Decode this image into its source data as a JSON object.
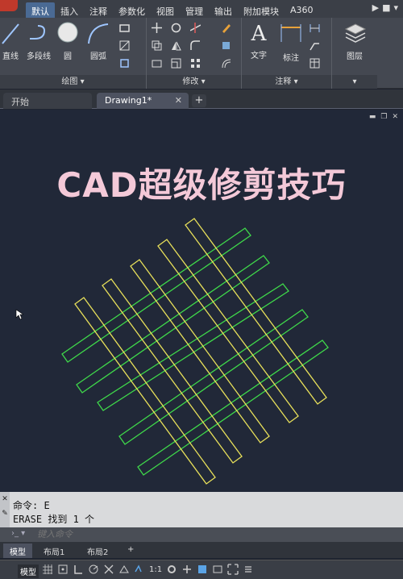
{
  "ribbon": {
    "tabs": [
      {
        "label": "默认",
        "active": true
      },
      {
        "label": "插入"
      },
      {
        "label": "注释"
      },
      {
        "label": "参数化"
      },
      {
        "label": "视图"
      },
      {
        "label": "管理"
      },
      {
        "label": "输出"
      },
      {
        "label": "附加模块"
      },
      {
        "label": "A360"
      }
    ],
    "panels": {
      "draw": {
        "title": "绘图",
        "line": "直线",
        "polyline": "多段线",
        "circle": "圆",
        "arc": "圆弧"
      },
      "modify": {
        "title": "修改"
      },
      "annotation": {
        "title": "注释",
        "text": "文字",
        "dimension": "标注"
      },
      "layers": {
        "label": "图层"
      }
    }
  },
  "doc_tabs": {
    "start": "开始",
    "drawing": "Drawing1*"
  },
  "canvas": {
    "headline": "CAD超级修剪技巧",
    "colors": {
      "yellow": "#e8e05a",
      "green": "#3fd94a",
      "background": "#212838"
    }
  },
  "command": {
    "history": [
      "命令: E",
      "ERASE 找到 1 个"
    ],
    "placeholder": "键入命令"
  },
  "layout_tabs": [
    "模型",
    "布局1",
    "布局2"
  ],
  "status": {
    "model": "模型",
    "scale": "1:1"
  }
}
